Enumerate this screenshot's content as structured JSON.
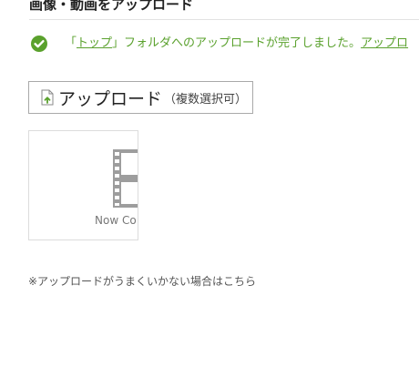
{
  "page": {
    "title": "画像・動画をアップロード"
  },
  "notice": {
    "status_color": "#5aa12d",
    "prefix": "「",
    "folder_link": "トップ",
    "message": "」フォルダへのアップロードが完了しました。",
    "trailing_link": "アップロ"
  },
  "upload_button": {
    "label": "アップロード",
    "sub_label": "（複数選択可）",
    "icon": "file-upload-icon"
  },
  "thumbnail": {
    "icon": "film-strip-icon",
    "caption": "Now Co"
  },
  "help": {
    "text": "※アップロードがうまくいかない場合はこちら"
  }
}
